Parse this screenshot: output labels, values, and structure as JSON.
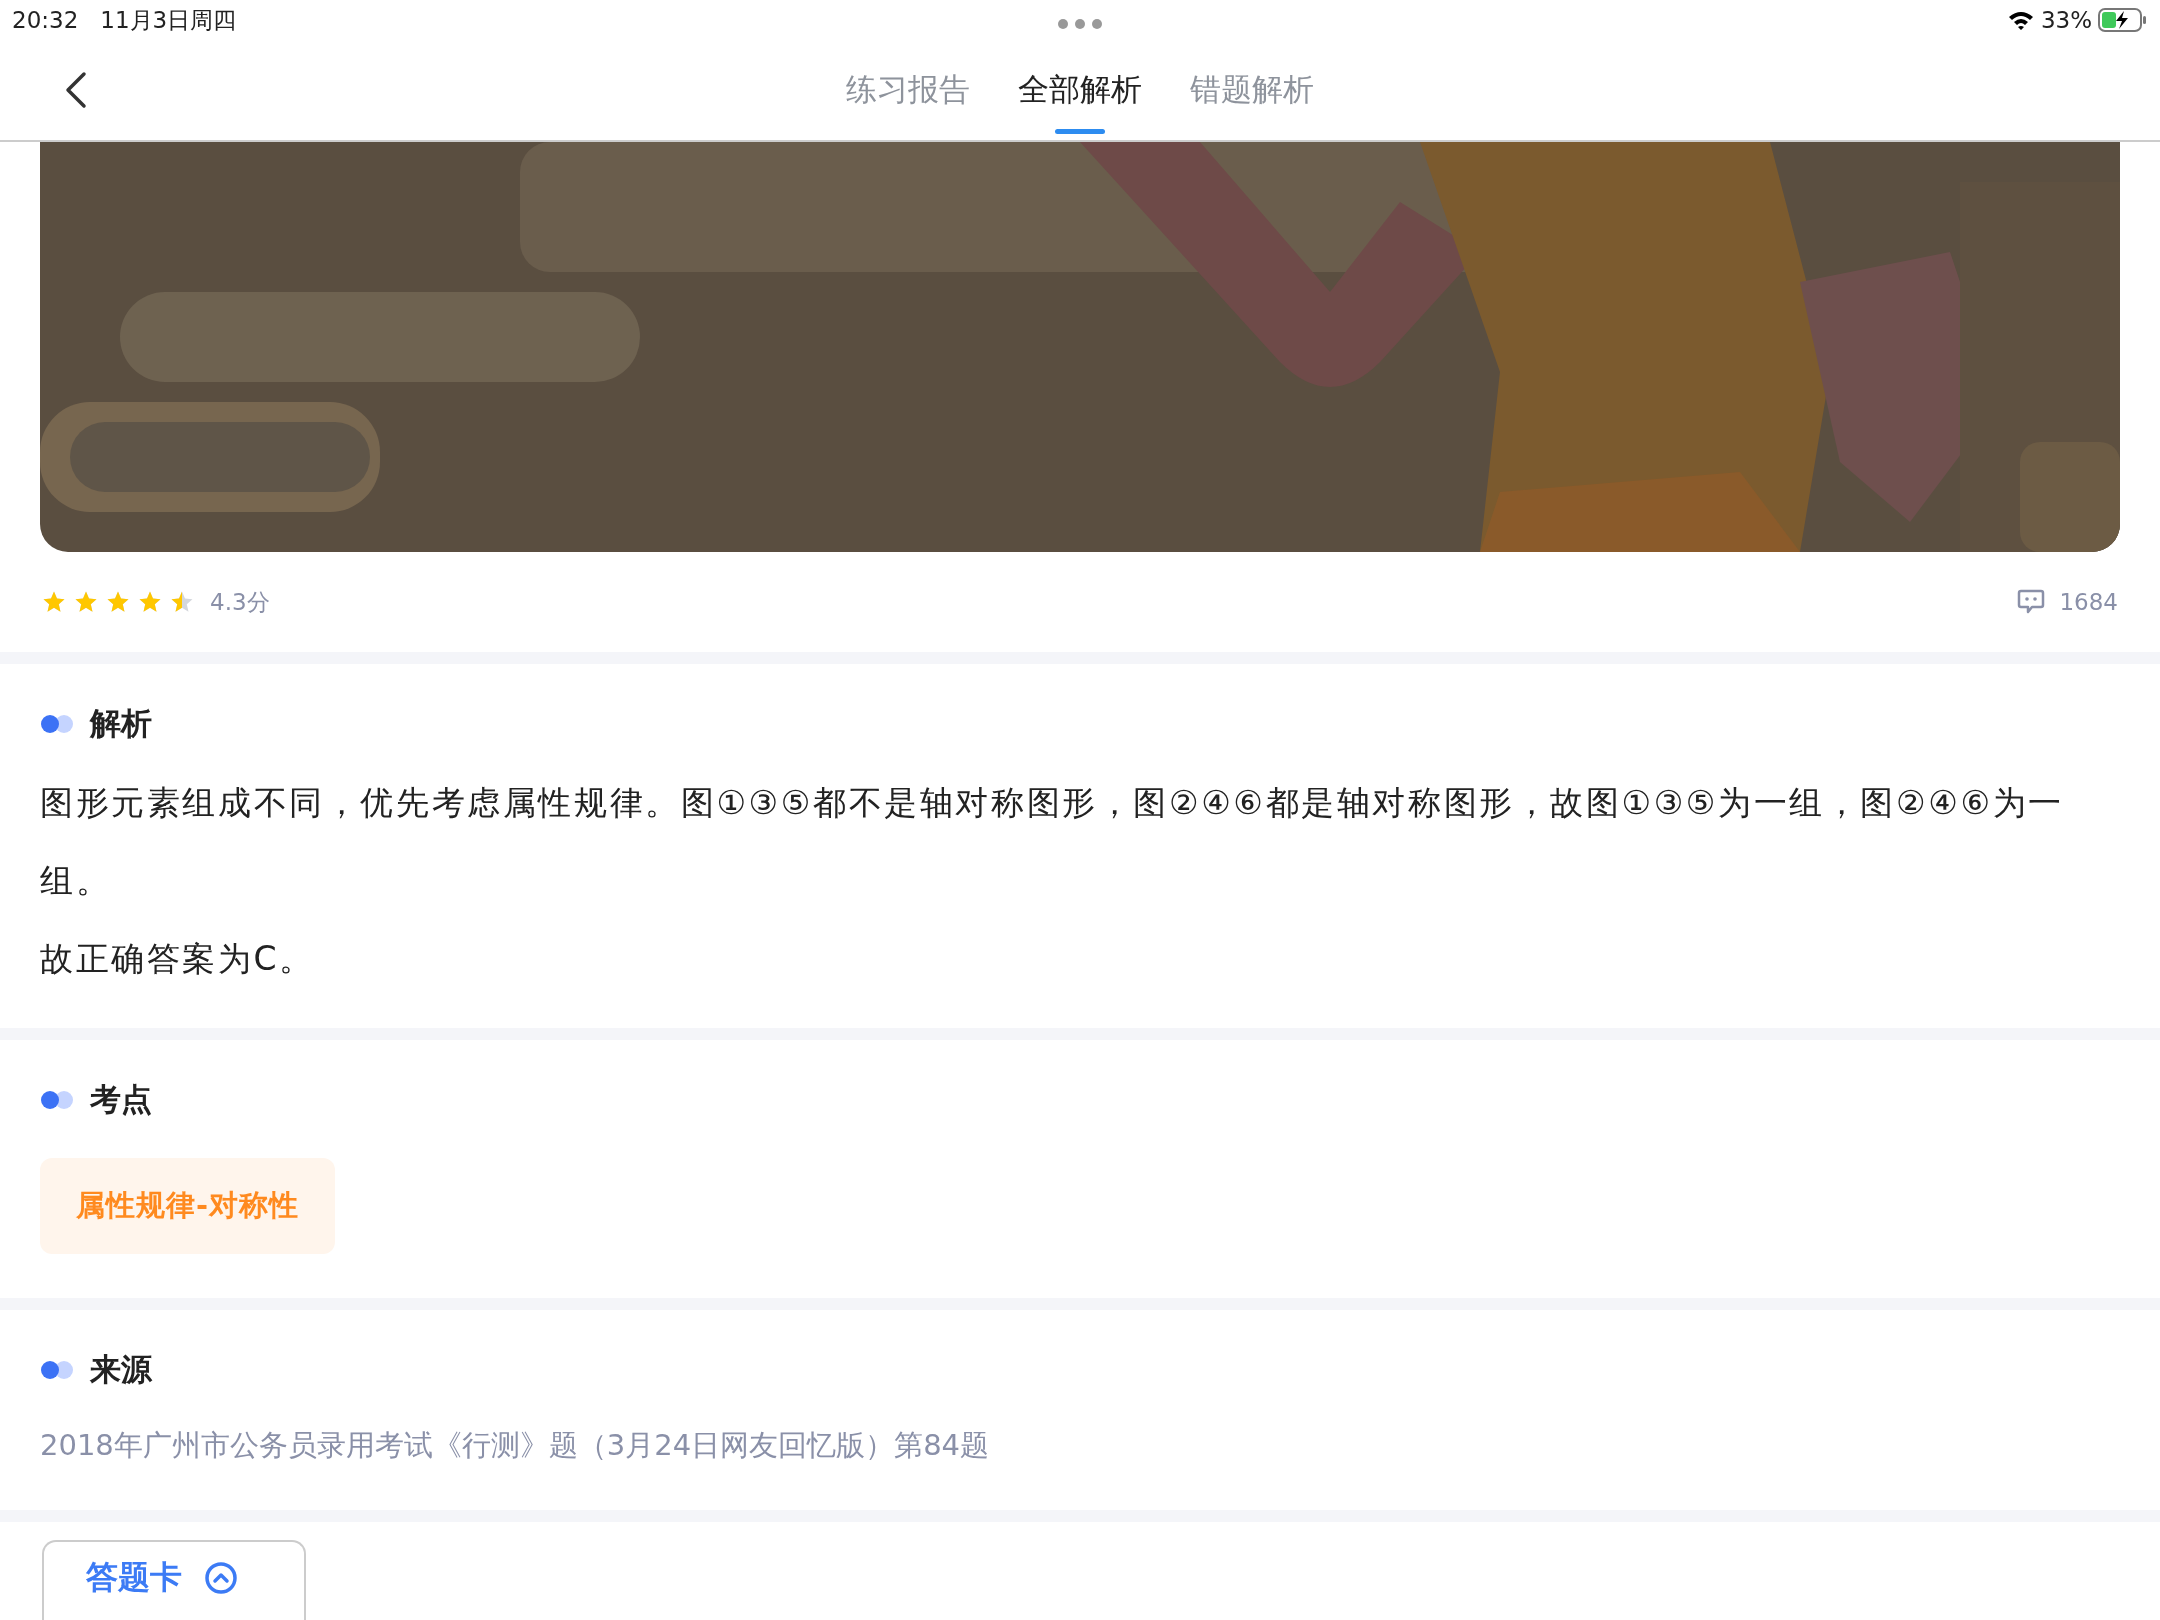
{
  "status_bar": {
    "time": "20:32",
    "date": "11月3日周四",
    "battery": "33%"
  },
  "nav": {
    "tabs": [
      {
        "label": "练习报告",
        "selected": false
      },
      {
        "label": "全部解析",
        "selected": true
      },
      {
        "label": "错题解析",
        "selected": false
      }
    ]
  },
  "rating": {
    "stars": 4.5,
    "score": "4.3分",
    "comments": "1684"
  },
  "analysis": {
    "title": "解析",
    "paragraphs": [
      "图形元素组成不同，优先考虑属性规律。图①③⑤都不是轴对称图形，图②④⑥都是轴对称图形，故图①③⑤为一组，图②④⑥为一组。",
      "故正确答案为C。"
    ]
  },
  "points": {
    "title": "考点",
    "tags": [
      "属性规律-对称性"
    ]
  },
  "source": {
    "title": "来源",
    "text": "2018年广州市公务员录用考试《行测》题（3月24日网友回忆版）第84题"
  },
  "answer_card": {
    "label": "答题卡"
  }
}
